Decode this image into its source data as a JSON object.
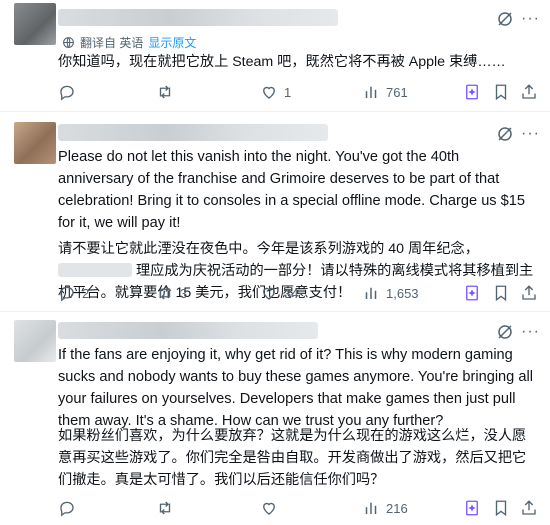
{
  "posts": [
    {
      "translated_label": "翻译自 英语",
      "show_original": "显示原文",
      "text": "你知道吗，现在就把它放上 Steam 吧，既然它将不再被 Apple 束缚……",
      "replies": "",
      "reposts": "",
      "likes": "1",
      "views": "761"
    },
    {
      "text_en": "Please do not let this vanish into the night. You've got the 40th anniversary of the franchise and Grimoire deserves to be part of that celebration! Bring it to consoles in a special offline mode. Charge us $15 for it, we will pay it!",
      "text_zh_1": "请不要让它就此湮没在夜色中。今年是该系列游戏的 40 周年纪念，",
      "text_zh_2": "理应成为庆祝活动的一部分！请以特殊的离线模式将其移植到主机平台。就算要价 15 美元，我们也愿意支付！",
      "replies": "2",
      "reposts": "3",
      "likes": "34",
      "views": "1,653"
    },
    {
      "text_en": "If the fans are enjoying it, why get rid of it? This is why modern gaming sucks and nobody wants to buy these games anymore. You're bringing all your failures on yourselves. Developers that make games then just pull them away. It's a shame. How can we trust you any further?",
      "text_zh": "如果粉丝们喜欢，为什么要放弃？这就是为什么现在的游戏这么烂，没人愿意再买这些游戏了。你们完全是咎由自取。开发商做出了游戏，然后又把它们撤走。真是太可惜了。我们以后还能信任你们吗？",
      "replies": "",
      "reposts": "",
      "likes": "",
      "views": "216"
    }
  ],
  "colors": {
    "text": "#0f1419",
    "muted": "#536471",
    "link": "#1d9bf0",
    "divider": "#eff3f4"
  },
  "icons": [
    "translate-icon",
    "grok-icon",
    "more-icon",
    "reply-icon",
    "repost-icon",
    "like-icon",
    "views-icon",
    "grok-analyze-icon",
    "bookmark-icon",
    "share-icon"
  ]
}
